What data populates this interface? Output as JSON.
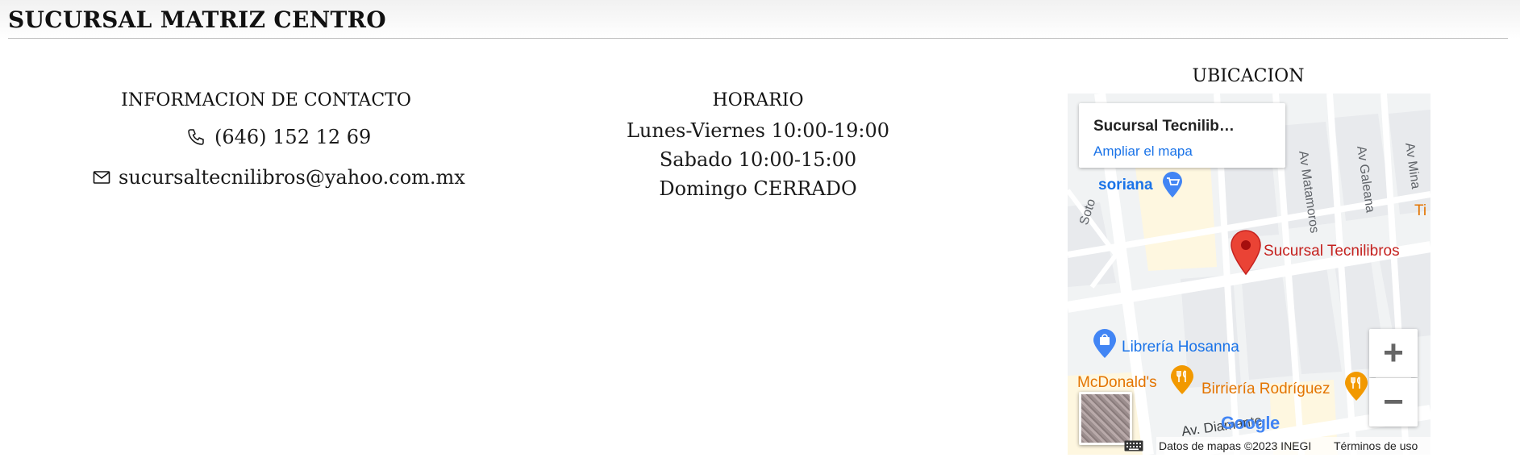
{
  "page": {
    "title": "SUCURSAL MATRIZ CENTRO"
  },
  "contact": {
    "heading": "INFORMACION DE CONTACTO",
    "phone": "(646) 152 12 69",
    "email": "sucursaltecnilibros@yahoo.com.mx",
    "phone_icon": "phone-icon",
    "email_icon": "mail-icon"
  },
  "horario": {
    "heading": "HORARIO",
    "lines": [
      "Lunes-Viernes 10:00-19:00",
      "Sabado 10:00-15:00",
      "Domingo CERRADO"
    ]
  },
  "ubicacion": {
    "heading": "UBICACION",
    "map": {
      "place_card": {
        "name": "Sucursal Tecnilib…",
        "link": "Ampliar el mapa"
      },
      "pin_label": "Sucursal Tecnilibros",
      "places": {
        "soriana": "soriana",
        "libreria": "Librería Hosanna",
        "mcdonalds": "McDonald's",
        "birrieria": "Birriería Rodríguez",
        "tr": "Ti"
      },
      "streets": {
        "matamoros": "Av Matamoros",
        "galeana": "Av Galeana",
        "mina": "Av Mina",
        "soto": "Soto",
        "diamante": "Av. Diamante"
      },
      "zoom_in": "+",
      "zoom_out": "−",
      "google": "Google",
      "attribution": "Datos de mapas ©2023 INEGI",
      "terms": "Términos de uso",
      "colors": {
        "pin": "#ea4335",
        "blue_poi": "#1a73e8",
        "orange_poi": "#e37400",
        "road": "#ffffff",
        "block": "#e8eaed",
        "park": "#fef7e0"
      }
    }
  }
}
